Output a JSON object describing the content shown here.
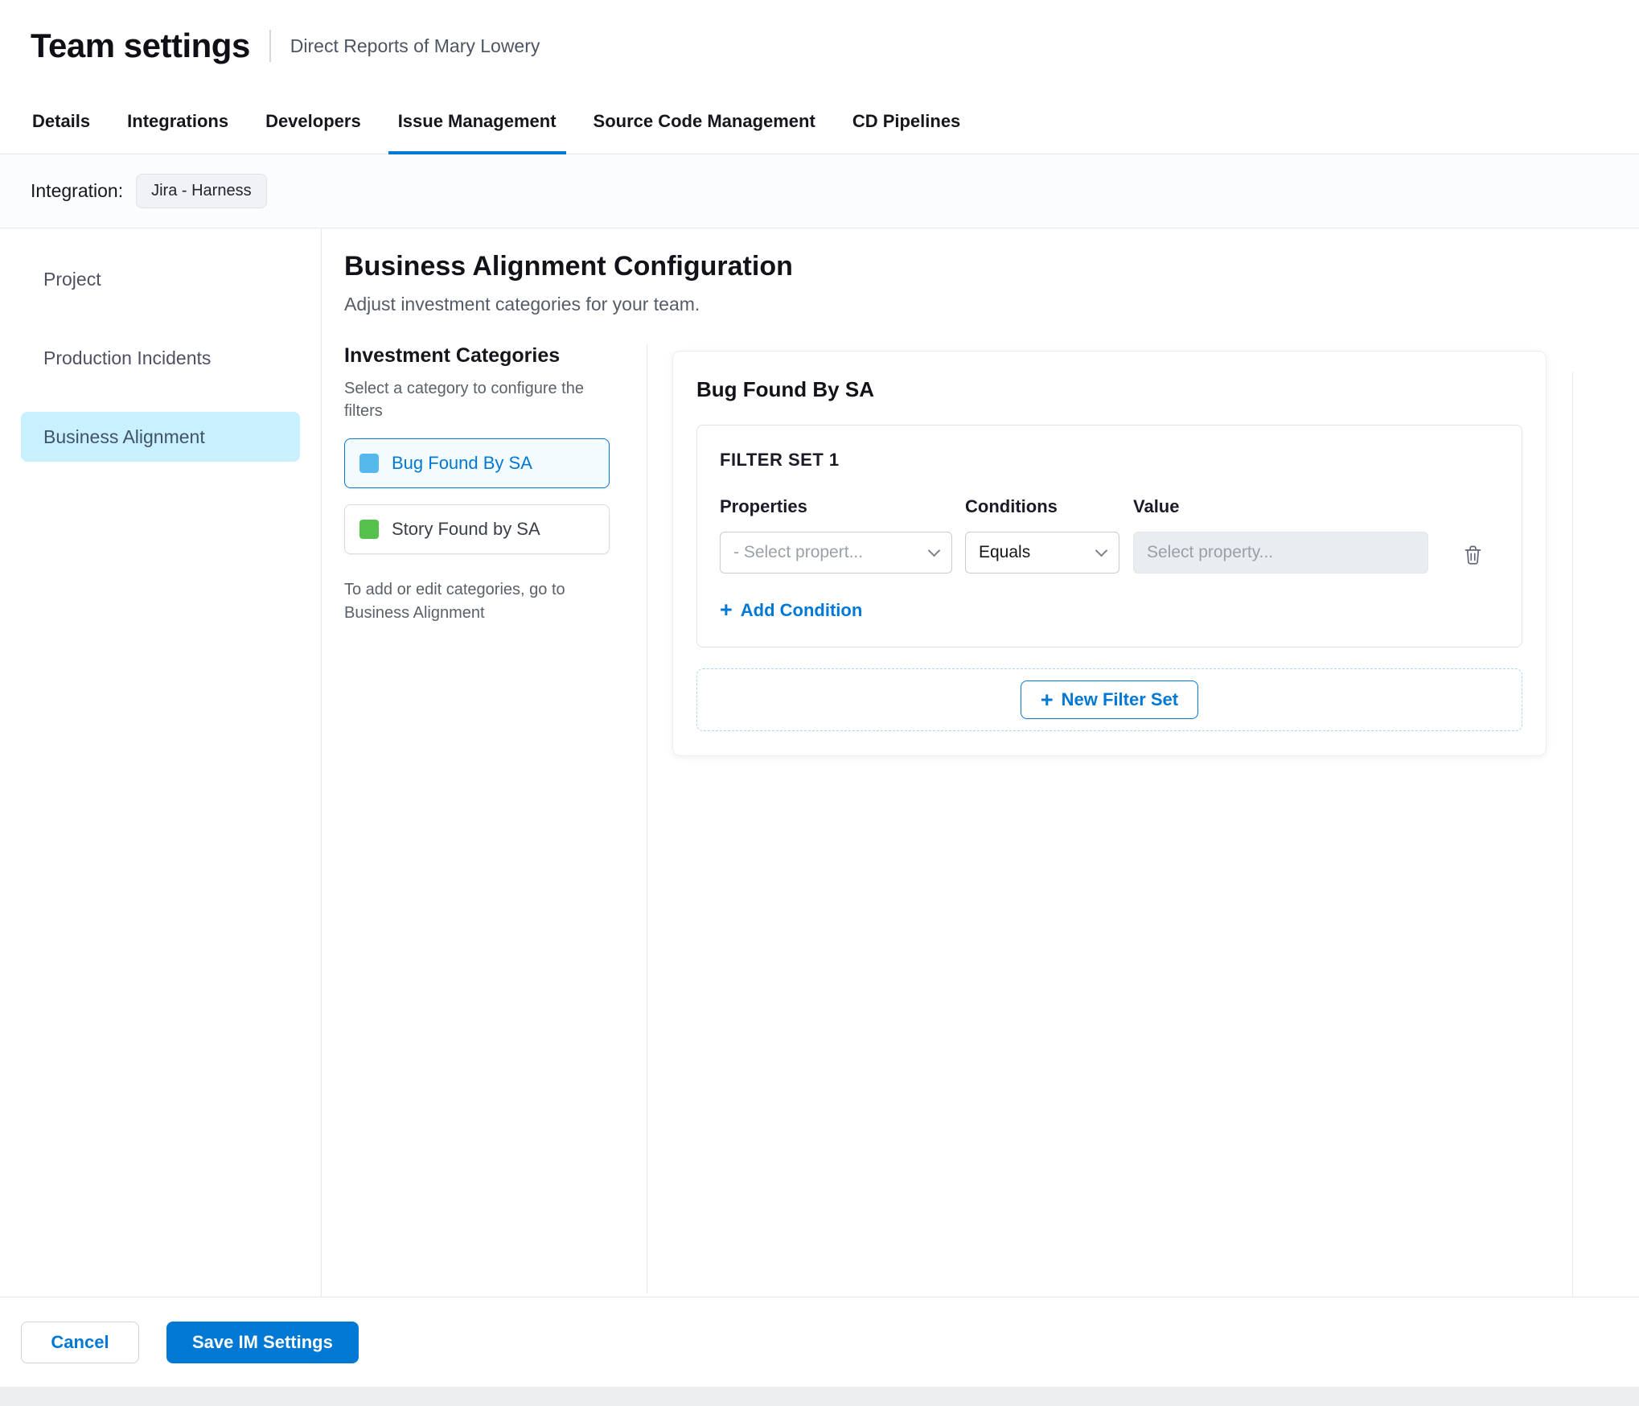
{
  "colors": {
    "accent": "#0278D5",
    "active_nav_bg": "#C9F0FE"
  },
  "header": {
    "title": "Team settings",
    "subtitle": "Direct Reports of Mary Lowery"
  },
  "tabs": [
    {
      "label": "Details"
    },
    {
      "label": "Integrations"
    },
    {
      "label": "Developers"
    },
    {
      "label": "Issue Management",
      "active": true
    },
    {
      "label": "Source Code Management"
    },
    {
      "label": "CD Pipelines"
    }
  ],
  "integration": {
    "label": "Integration:",
    "value": "Jira - Harness"
  },
  "sidebar": {
    "items": [
      {
        "label": "Project"
      },
      {
        "label": "Production Incidents"
      },
      {
        "label": "Business Alignment",
        "active": true
      }
    ]
  },
  "main": {
    "title": "Business Alignment Configuration",
    "subtitle": "Adjust investment categories for your team.",
    "categories": {
      "title": "Investment Categories",
      "hint": "Select a category to configure the filters",
      "items": [
        {
          "label": "Bug Found By SA",
          "color": "#55B8EC",
          "active": true
        },
        {
          "label": "Story Found by SA",
          "color": "#57C14E",
          "active": false
        }
      ],
      "note": "To add or edit categories, go to Business Alignment"
    },
    "panel": {
      "title": "Bug Found By SA",
      "filter_set": {
        "title": "FILTER SET 1",
        "properties_label": "Properties",
        "conditions_label": "Conditions",
        "value_label": "Value",
        "property_placeholder": "- Select propert...",
        "condition_value": "Equals",
        "value_placeholder": "Select property...",
        "add_condition_label": "Add Condition"
      },
      "new_filter_set_label": "New Filter Set"
    }
  },
  "footer": {
    "cancel_label": "Cancel",
    "save_label": "Save IM Settings"
  },
  "icons": {
    "plus": "+"
  }
}
